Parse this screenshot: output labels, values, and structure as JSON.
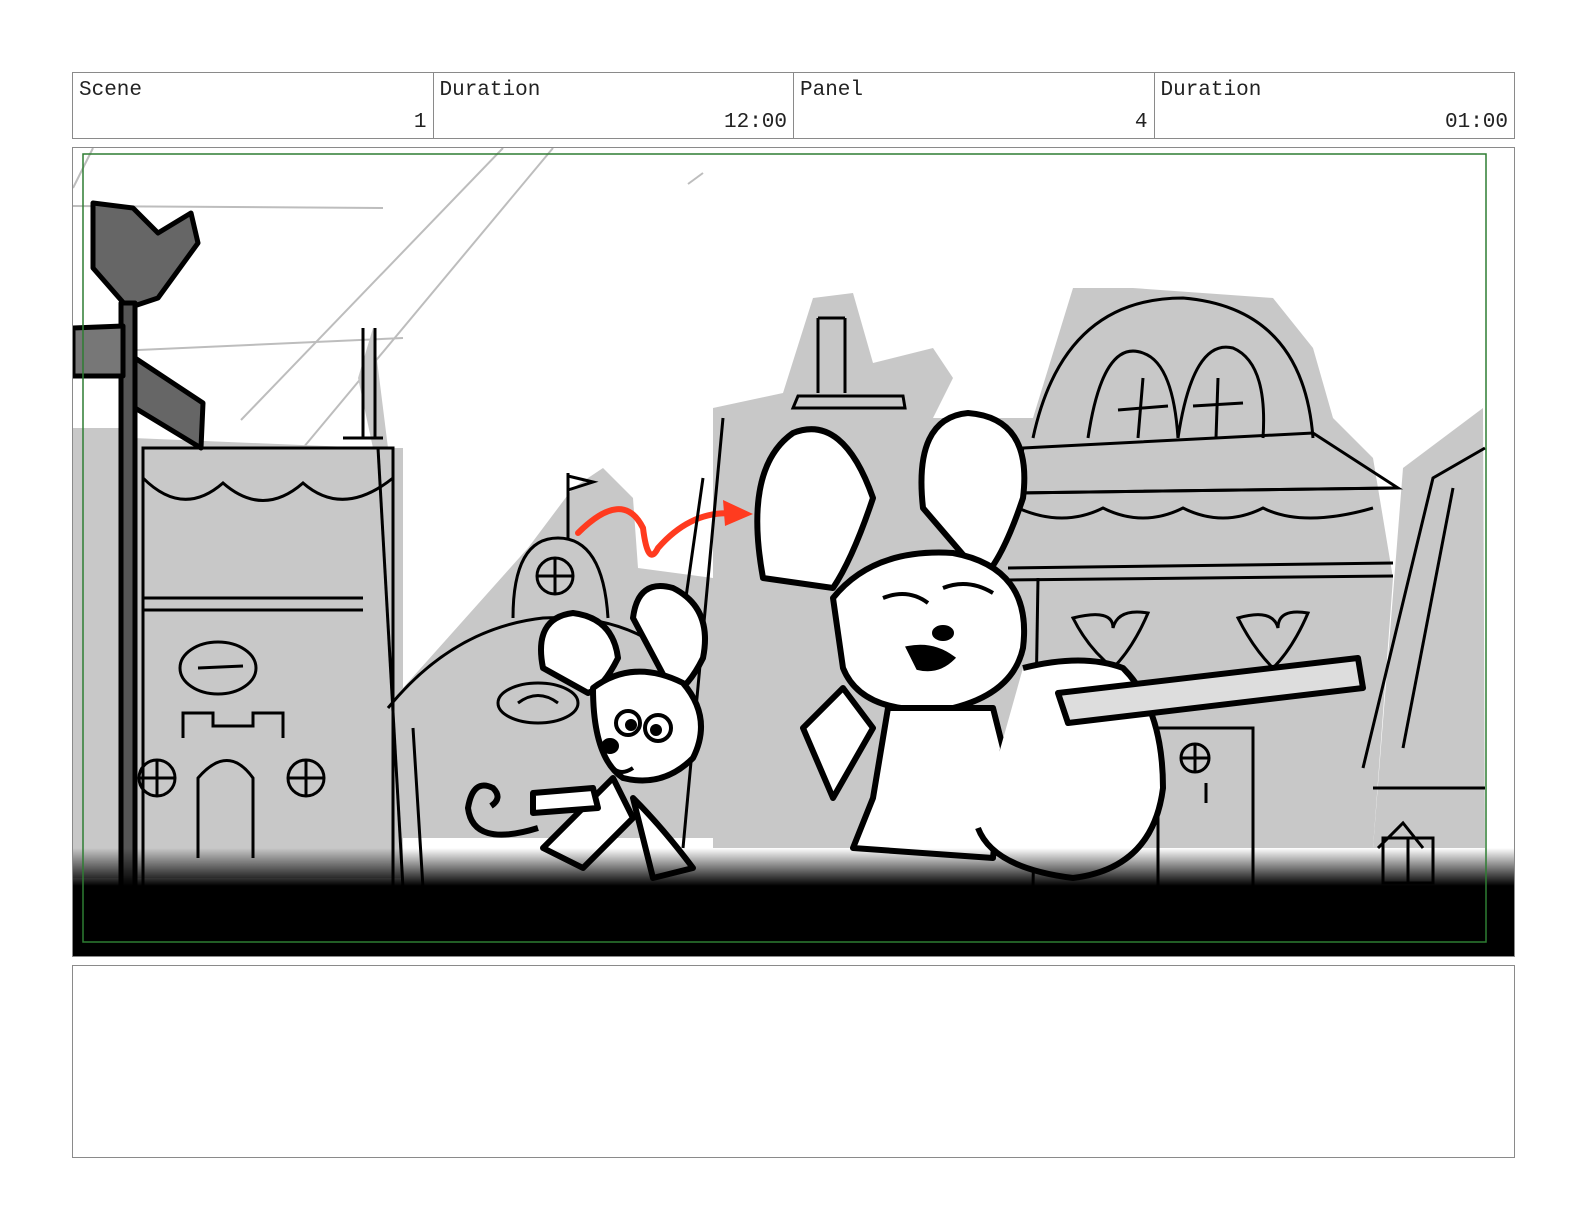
{
  "header": {
    "scene_label": "Scene",
    "scene_value": "1",
    "duration_label": "Duration",
    "duration_value": "12:00",
    "panel_label": "Panel",
    "panel_value": "4",
    "panel_duration_label": "Duration",
    "panel_duration_value": "01:00"
  },
  "colors": {
    "safe_frame": "#2e7d32",
    "arrow": "#ff3b1f",
    "building_gray": "#c8c8c8"
  }
}
